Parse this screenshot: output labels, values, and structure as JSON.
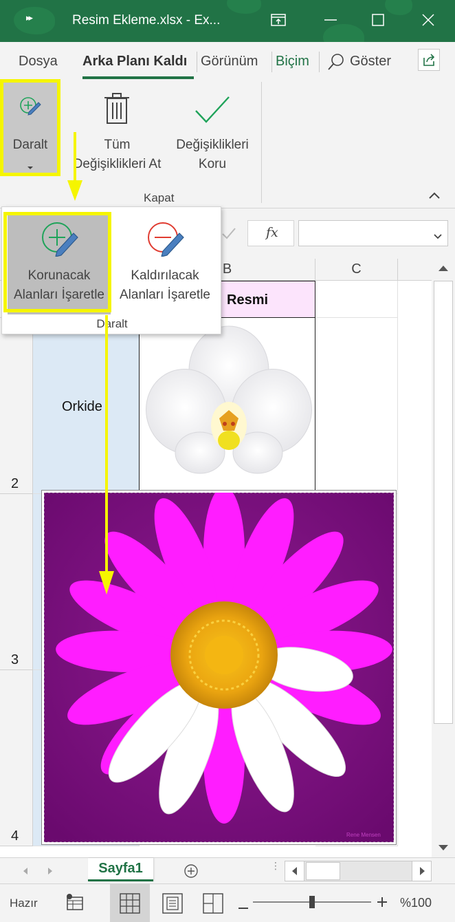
{
  "window": {
    "title": "Resim Ekleme.xlsx  -  Ex...",
    "accent": "#217346"
  },
  "tabs": {
    "dosya": "Dosya",
    "arka_plani_kaldir": "Arka Planı Kaldı",
    "gorunum": "Görünüm",
    "bicim": "Biçim",
    "goster": "Göster"
  },
  "ribbon": {
    "daralt_label": "Daralt",
    "tum_degisiklikleri_at_line1": "Tüm",
    "tum_degisiklikleri_at_line2": "Değişiklikleri At",
    "degisiklikleri_koru_line1": "Değişiklikleri",
    "degisiklikleri_koru_line2": "Koru",
    "group_label": "Kapat"
  },
  "dropdown": {
    "korunacak_line1": "Korunacak",
    "korunacak_line2": "Alanları İşaretle",
    "kaldirilacak_line1": "Kaldırılacak",
    "kaldirilacak_line2": "Alanları İşaretle",
    "group_label": "Daralt"
  },
  "formula_bar": {
    "fx": "fx"
  },
  "grid": {
    "col_b": "B",
    "col_c": "C",
    "header_b": "Resmi",
    "row2_a": "Orkide",
    "row_numbers": [
      "2",
      "3",
      "4"
    ],
    "picture_credit": "Rene Mensen",
    "header_fill": "#fce4fc",
    "col_a_fill": "#dce9f5",
    "marked_color": "#7d0a80"
  },
  "sheets": {
    "active": "Sayfa1"
  },
  "status": {
    "ready": "Hazır",
    "zoom": "%100"
  }
}
